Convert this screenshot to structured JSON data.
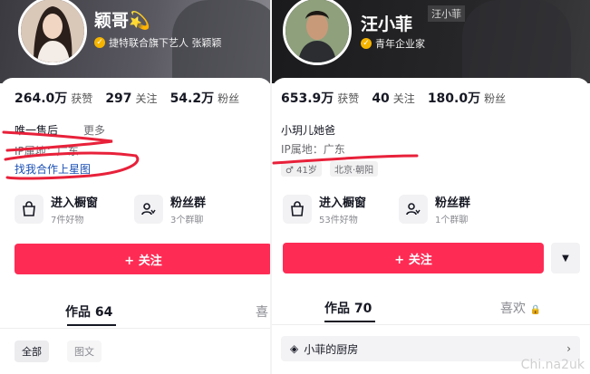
{
  "left": {
    "name": "颖哥💫",
    "verify_text": "捷特联合旗下艺人 张颖颖",
    "stats": [
      {
        "value": "264.0万",
        "label": "获赞"
      },
      {
        "value": "297",
        "label": "关注"
      },
      {
        "value": "54.2万",
        "label": "粉丝"
      }
    ],
    "bio_partial": "唯一售后",
    "bio_more": "更多",
    "ip_location": "IP属地：广东",
    "contact_link": "找我合作上星图",
    "shop": [
      {
        "title": "进入橱窗",
        "sub": "7件好物",
        "icon": "bag-icon"
      },
      {
        "title": "粉丝群",
        "sub": "3个群聊",
        "icon": "fan-group-icon"
      }
    ],
    "follow_label": "+ 关注",
    "tabs": [
      {
        "label": "作品 64",
        "active": true
      },
      {
        "label": "喜",
        "active": false
      }
    ],
    "filters": [
      {
        "label": "全部",
        "active": true
      },
      {
        "label": "图文",
        "active": false
      }
    ]
  },
  "right": {
    "name": "汪小菲",
    "corner_tag": "汪小菲",
    "verify_text": "青年企业家",
    "stats": [
      {
        "value": "653.9万",
        "label": "获赞"
      },
      {
        "value": "40",
        "label": "关注"
      },
      {
        "value": "180.0万",
        "label": "粉丝"
      }
    ],
    "bio": "小玥儿她爸",
    "ip_location": "IP属地：广东",
    "tags": [
      "♂ 41岁",
      "北京·朝阳"
    ],
    "shop": [
      {
        "title": "进入橱窗",
        "sub": "53件好物",
        "icon": "bag-icon"
      },
      {
        "title": "粉丝群",
        "sub": "1个群聊",
        "icon": "fan-group-icon"
      }
    ],
    "follow_label": "+ 关注",
    "tabs": [
      {
        "label": "作品 70",
        "active": true
      },
      {
        "label": "喜欢",
        "active": false
      }
    ],
    "collection_label": "小菲的厨房"
  },
  "watermark": "Chi.na2uk",
  "colors": {
    "accent": "#fe2c55",
    "link": "#1a4fb4",
    "scribble": "#e8213a"
  }
}
